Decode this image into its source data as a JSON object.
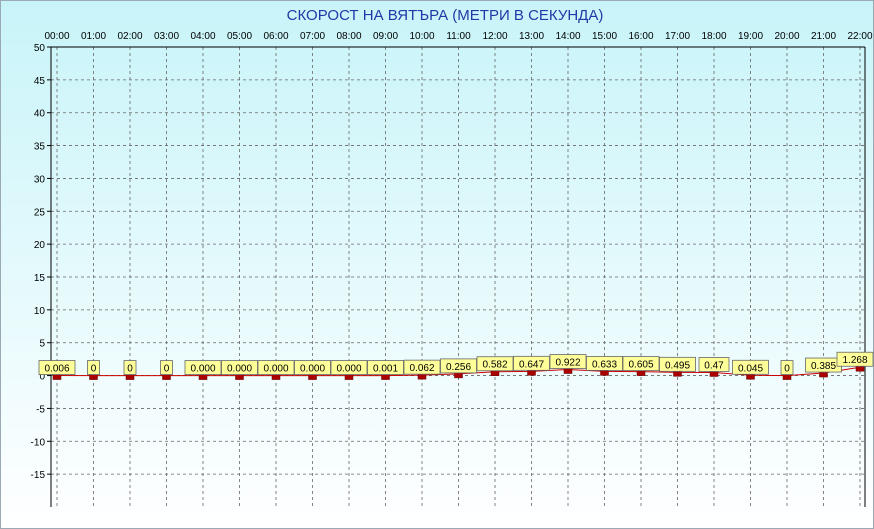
{
  "chart_data": {
    "type": "line",
    "title": "СКОРОСТ НА ВЯТЪРА (МЕТРИ В СЕКУНДА)",
    "xlabel": "",
    "ylabel": "",
    "ylim": [
      -20,
      50
    ],
    "yticks": [
      "50",
      "45",
      "40",
      "35",
      "30",
      "25",
      "20",
      "15",
      "10",
      "5",
      "0",
      "-5",
      "-10",
      "-15"
    ],
    "ytick_values": [
      50,
      45,
      40,
      35,
      30,
      25,
      20,
      15,
      10,
      5,
      0,
      -5,
      -10,
      -15
    ],
    "categories": [
      "00:00",
      "01:00",
      "02:00",
      "03:00",
      "04:00",
      "05:00",
      "06:00",
      "07:00",
      "08:00",
      "09:00",
      "10:00",
      "11:00",
      "12:00",
      "13:00",
      "14:00",
      "15:00",
      "16:00",
      "17:00",
      "18:00",
      "19:00",
      "20:00",
      "21:00",
      "22:00"
    ],
    "series": [
      {
        "values": [
          0.006,
          0,
          0,
          0,
          0.0,
          0.0,
          0.0,
          0.0,
          0.0,
          0.001,
          0.062,
          0.256,
          0.582,
          0.647,
          0.922,
          0.633,
          0.605,
          0.495,
          0.47,
          0.045,
          0,
          0.385,
          1.268
        ],
        "labels": [
          "0.006",
          "0",
          "0",
          "0",
          "0.000",
          "0.000",
          "0.000",
          "0.000",
          "0.000",
          "0.001",
          "0.062",
          "0.256",
          "0.582",
          "0.647",
          "0.922",
          "0.633",
          "0.605",
          "0.495",
          "0.47",
          "0.045",
          "0",
          "0.385",
          "1.268"
        ]
      }
    ],
    "grid": true,
    "colors": {
      "line": "#cc0000",
      "marker": "#aa0000",
      "label_fill": "#ffff99",
      "title": "#1f3aa6",
      "plot_top": "#c8f4f9",
      "plot_bottom": "#ffffff"
    }
  }
}
